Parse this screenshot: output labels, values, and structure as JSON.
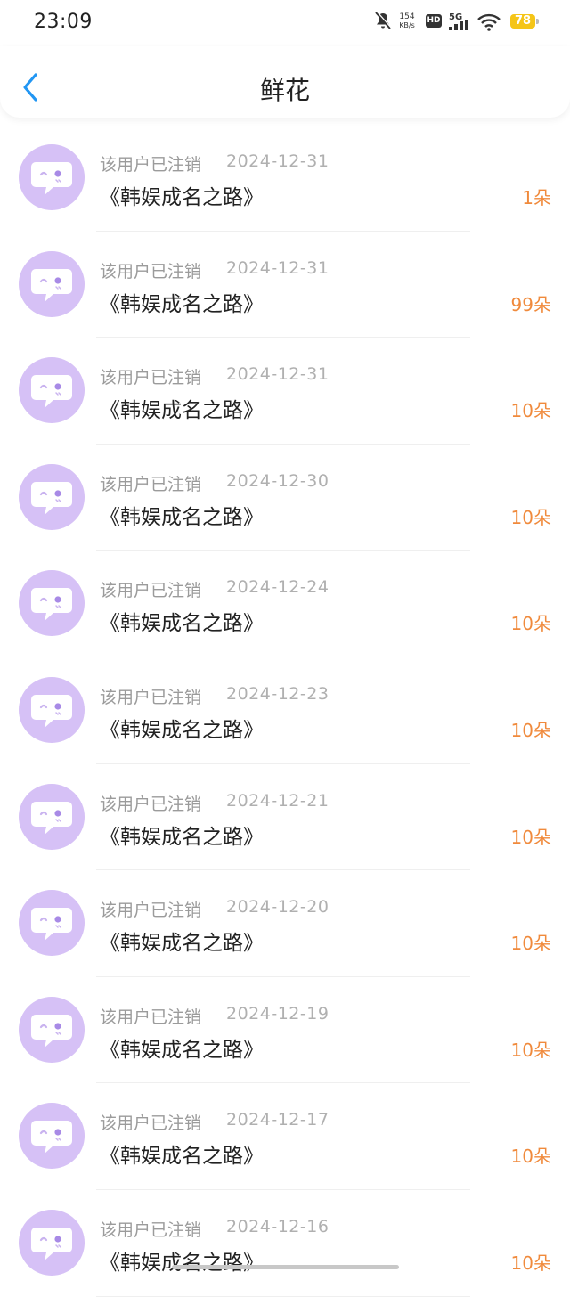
{
  "status_bar": {
    "time": "23:09",
    "net_speed_value": "154",
    "net_speed_unit": "KB/s",
    "hd_label": "HD",
    "network_label": "5G",
    "battery": "78"
  },
  "header": {
    "title": "鲜花"
  },
  "records": [
    {
      "user": "该用户已注销",
      "date": "2024-12-31",
      "book": "《韩娱成名之路》",
      "count": "1朵"
    },
    {
      "user": "该用户已注销",
      "date": "2024-12-31",
      "book": "《韩娱成名之路》",
      "count": "99朵"
    },
    {
      "user": "该用户已注销",
      "date": "2024-12-31",
      "book": "《韩娱成名之路》",
      "count": "10朵"
    },
    {
      "user": "该用户已注销",
      "date": "2024-12-30",
      "book": "《韩娱成名之路》",
      "count": "10朵"
    },
    {
      "user": "该用户已注销",
      "date": "2024-12-24",
      "book": "《韩娱成名之路》",
      "count": "10朵"
    },
    {
      "user": "该用户已注销",
      "date": "2024-12-23",
      "book": "《韩娱成名之路》",
      "count": "10朵"
    },
    {
      "user": "该用户已注销",
      "date": "2024-12-21",
      "book": "《韩娱成名之路》",
      "count": "10朵"
    },
    {
      "user": "该用户已注销",
      "date": "2024-12-20",
      "book": "《韩娱成名之路》",
      "count": "10朵"
    },
    {
      "user": "该用户已注销",
      "date": "2024-12-19",
      "book": "《韩娱成名之路》",
      "count": "10朵"
    },
    {
      "user": "该用户已注销",
      "date": "2024-12-17",
      "book": "《韩娱成名之路》",
      "count": "10朵"
    },
    {
      "user": "该用户已注销",
      "date": "2024-12-16",
      "book": "《韩娱成名之路》",
      "count": "10朵"
    }
  ],
  "colors": {
    "accent_blue": "#2196f3",
    "count_orange": "#f08a3c",
    "avatar_purple": "#d6c1f6"
  },
  "icons": {
    "back": "chevron-left-icon",
    "avatar": "chat-bubble-face-icon",
    "notifications": "bell-muted-icon",
    "wifi": "wifi-icon",
    "signal": "signal-bars-icon",
    "battery": "battery-icon"
  }
}
